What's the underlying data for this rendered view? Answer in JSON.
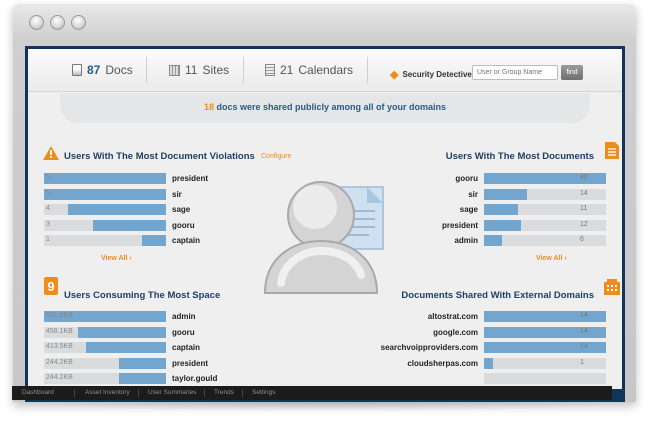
{
  "window": {
    "controls": [
      "close-button",
      "minimize-button",
      "zoom-button"
    ]
  },
  "stats": {
    "docs": {
      "count": "87",
      "label": "Docs"
    },
    "sites": {
      "count": "11",
      "label": "Sites"
    },
    "calendars": {
      "count": "21",
      "label": "Calendars"
    }
  },
  "security": {
    "label": "Security Detective",
    "search_placeholder": "User or Group Name",
    "find_label": "find"
  },
  "banner": {
    "count": "18",
    "text": " docs were shared publicly among all of your domains"
  },
  "panels": {
    "violations": {
      "title": "Users With The Most Document Violations",
      "configure": "Configure",
      "view_all": "View All",
      "rows": [
        {
          "value": "5",
          "name": "president",
          "fraction": 1.0
        },
        {
          "value": "5",
          "name": "sir",
          "fraction": 1.0
        },
        {
          "value": "4",
          "name": "sage",
          "fraction": 0.8
        },
        {
          "value": "3",
          "name": "gooru",
          "fraction": 0.6
        },
        {
          "value": "1",
          "name": "captain",
          "fraction": 0.2
        }
      ]
    },
    "most_documents": {
      "title": "Users With The Most Documents",
      "view_all": "View All",
      "rows": [
        {
          "value": "40",
          "name": "gooru",
          "fraction": 1.0
        },
        {
          "value": "14",
          "name": "sir",
          "fraction": 0.35
        },
        {
          "value": "11",
          "name": "sage",
          "fraction": 0.275
        },
        {
          "value": "12",
          "name": "president",
          "fraction": 0.3
        },
        {
          "value": "6",
          "name": "admin",
          "fraction": 0.15
        }
      ]
    },
    "space": {
      "title": "Users Consuming The Most Space",
      "rows": [
        {
          "value": "631.6KB",
          "name": "admin",
          "fraction": 1.0
        },
        {
          "value": "458.1KB",
          "name": "gooru",
          "fraction": 0.725
        },
        {
          "value": "413.5KB",
          "name": "captain",
          "fraction": 0.655
        },
        {
          "value": "244.2KB",
          "name": "president",
          "fraction": 0.387
        },
        {
          "value": "244.2KB",
          "name": "taylor.gould",
          "fraction": 0.387
        }
      ]
    },
    "external": {
      "title": "Documents Shared With External Domains",
      "rows": [
        {
          "value": "14",
          "name": "altostrat.com",
          "fraction": 1.0
        },
        {
          "value": "14",
          "name": "google.com",
          "fraction": 1.0
        },
        {
          "value": "14",
          "name": "searchvoipproviders.com",
          "fraction": 1.0
        },
        {
          "value": "1",
          "name": "cloudsherpas.com",
          "fraction": 0.071
        },
        {
          "value": "",
          "name": "",
          "fraction": 0
        }
      ]
    }
  },
  "nav": [
    "Dashboard",
    "Asset Inventory",
    "User Summaries",
    "Trends",
    "Settings"
  ],
  "colors": {
    "accent": "#f08c1a",
    "bar": "#72a6cf",
    "frame": "#12345a",
    "title": "#1f3f66"
  }
}
